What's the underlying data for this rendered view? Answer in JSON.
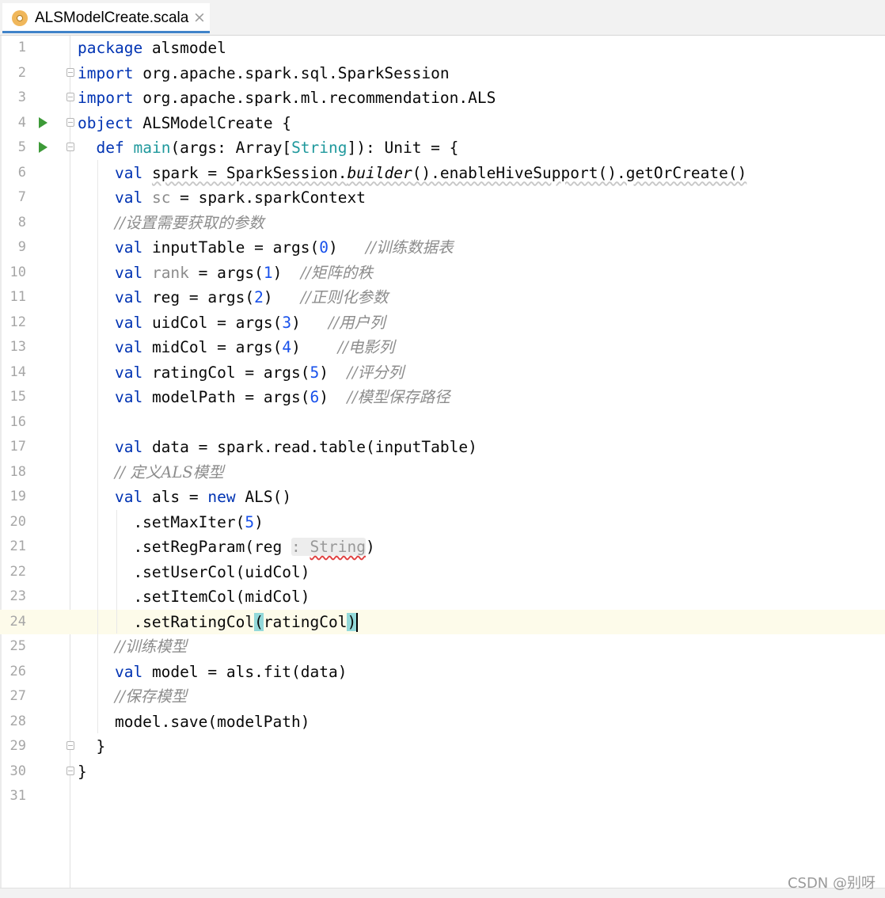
{
  "tab": {
    "title": "ALSModelCreate.scala",
    "close": "×",
    "icon": "scala-file-icon"
  },
  "current_line": 24,
  "code_lines": [
    {
      "n": "1",
      "html": "<span class=\"kw\">package</span> alsmodel"
    },
    {
      "n": "2",
      "html": "<span class=\"kw\">import</span> org.apache.spark.sql.SparkSession"
    },
    {
      "n": "3",
      "html": "<span class=\"kw\">import</span> org.apache.spark.ml.recommendation.ALS"
    },
    {
      "n": "4",
      "html": "<span class=\"kw\">object</span> ALSModelCreate {"
    },
    {
      "n": "5",
      "html": "  <span class=\"kw\">def</span> <span class=\"tp\">main</span>(args: Array[<span class=\"tp\">String</span>]): Unit = {"
    },
    {
      "n": "6",
      "html": "    <span class=\"kw\">val</span> <span class=\"wavy\">spark = SparkSession.<span class=\"it\">builder</span>().enableHiveSupport().getOrCreate()</span>"
    },
    {
      "n": "7",
      "html": "    <span class=\"kw\">val</span> <span class=\"unused\">sc</span> = spark.sparkContext"
    },
    {
      "n": "8",
      "html": "    <span class=\"cm\">//设置需要获取的参数</span>"
    },
    {
      "n": "9",
      "html": "    <span class=\"kw\">val</span> inputTable = args(<span class=\"num\">0</span>)   <span class=\"cm\">//训练数据表</span>"
    },
    {
      "n": "10",
      "html": "    <span class=\"kw\">val</span> <span class=\"unused\">rank</span> = args(<span class=\"num\">1</span>)  <span class=\"cm\">//矩阵的秩</span>"
    },
    {
      "n": "11",
      "html": "    <span class=\"kw\">val</span> reg = args(<span class=\"num\">2</span>)   <span class=\"cm\">//正则化参数</span>"
    },
    {
      "n": "12",
      "html": "    <span class=\"kw\">val</span> uidCol = args(<span class=\"num\">3</span>)   <span class=\"cm\">//用户列</span>"
    },
    {
      "n": "13",
      "html": "    <span class=\"kw\">val</span> midCol = args(<span class=\"num\">4</span>)    <span class=\"cm\">//电影列</span>"
    },
    {
      "n": "14",
      "html": "    <span class=\"kw\">val</span> ratingCol = args(<span class=\"num\">5</span>)  <span class=\"cm\">//评分列</span>"
    },
    {
      "n": "15",
      "html": "    <span class=\"kw\">val</span> modelPath = args(<span class=\"num\">6</span>)  <span class=\"cm\">//模型保存路径</span>"
    },
    {
      "n": "16",
      "html": ""
    },
    {
      "n": "17",
      "html": "    <span class=\"kw\">val</span> data = spark.read.table(inputTable)"
    },
    {
      "n": "18",
      "html": "    <span class=\"cm\">// 定义ALS模型</span>"
    },
    {
      "n": "19",
      "html": "    <span class=\"kw\">val</span> als = <span class=\"kw\">new</span> ALS()"
    },
    {
      "n": "20",
      "html": "      .setMaxIter(<span class=\"num\">5</span>)"
    },
    {
      "n": "21",
      "html": "      .setRegParam(reg <span class=\"hint\">: <span class=\"squig\">String</span></span>)"
    },
    {
      "n": "22",
      "html": "      .setUserCol(uidCol)"
    },
    {
      "n": "23",
      "html": "      .setItemCol(midCol)"
    },
    {
      "n": "24",
      "html": "      .setRatingCol<span class=\"brace-hl\">(</span>ratingCol<span class=\"brace-hl\">)</span><span class=\"caret\"></span>"
    },
    {
      "n": "25",
      "html": "    <span class=\"cm\">//训练模型</span>"
    },
    {
      "n": "26",
      "html": "    <span class=\"kw\">val</span> model = als.fit(data)"
    },
    {
      "n": "27",
      "html": "    <span class=\"cm\">//保存模型</span>"
    },
    {
      "n": "28",
      "html": "    model.save(modelPath)"
    },
    {
      "n": "29",
      "html": "  }"
    },
    {
      "n": "30",
      "html": "}"
    },
    {
      "n": "31",
      "html": ""
    }
  ],
  "run_markers": [
    "4",
    "5"
  ],
  "fold_markers": [
    "2",
    "3",
    "4",
    "5",
    "29",
    "30"
  ],
  "watermark": "CSDN @别呀"
}
